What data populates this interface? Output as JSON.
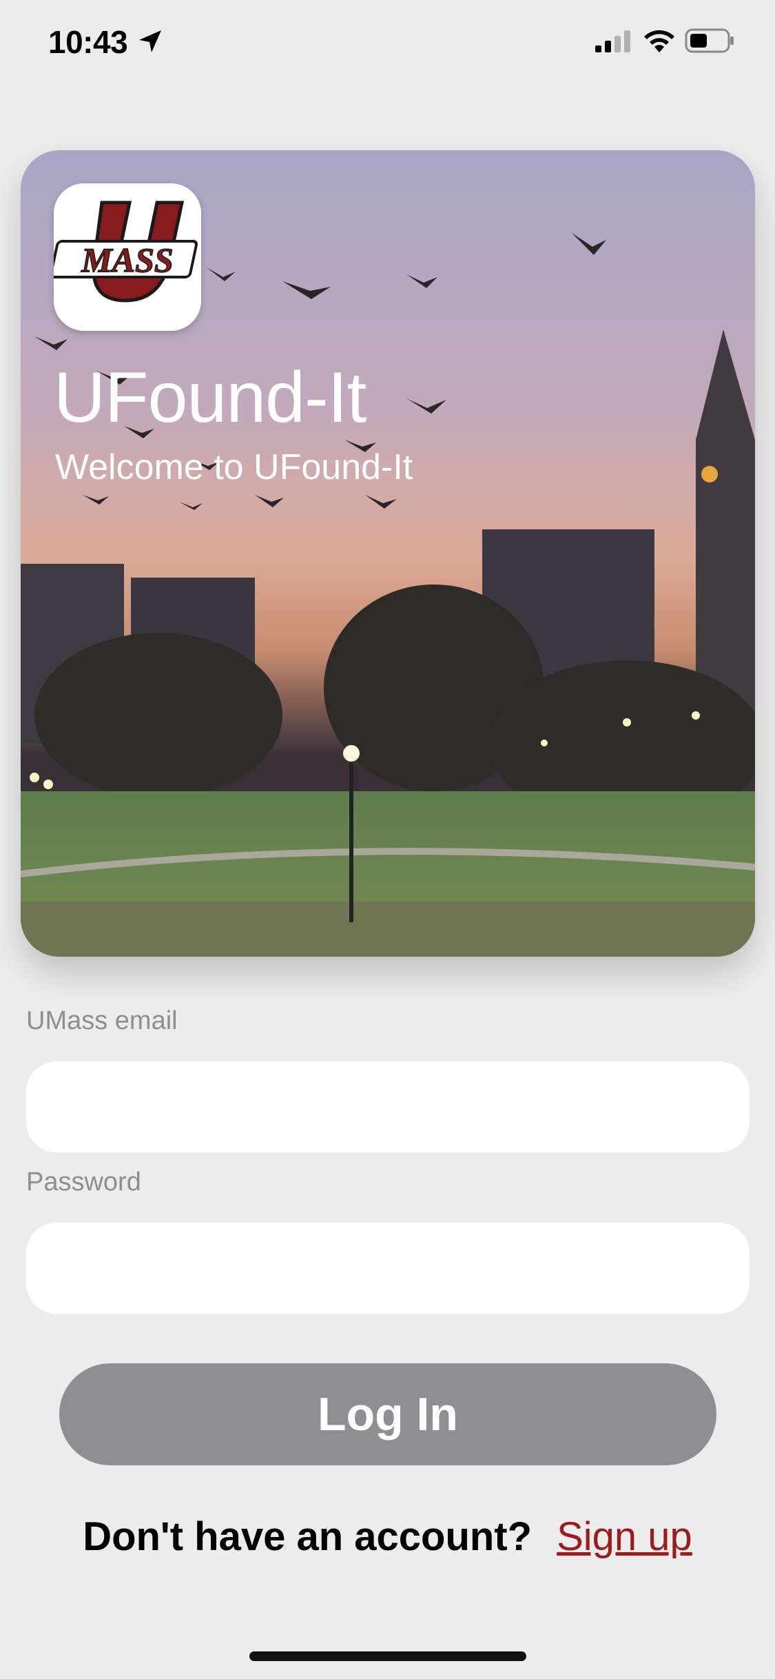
{
  "status_bar": {
    "time": "10:43",
    "icons": [
      "location-arrow-icon",
      "cellular-signal-icon",
      "wifi-icon",
      "battery-icon"
    ]
  },
  "hero": {
    "logo_text": "MASS",
    "title": "UFound-It",
    "subtitle": "Welcome to UFound-It"
  },
  "form": {
    "email_label": "UMass email",
    "email_value": "",
    "password_label": "Password",
    "password_value": "",
    "login_label": "Log In"
  },
  "signup": {
    "prompt": "Don't have an account?",
    "link_label": "Sign up"
  },
  "colors": {
    "background": "#ececec",
    "brand_maroon": "#881c1c",
    "button_gray": "#8e8e93",
    "link_red": "#9e1b1b"
  }
}
